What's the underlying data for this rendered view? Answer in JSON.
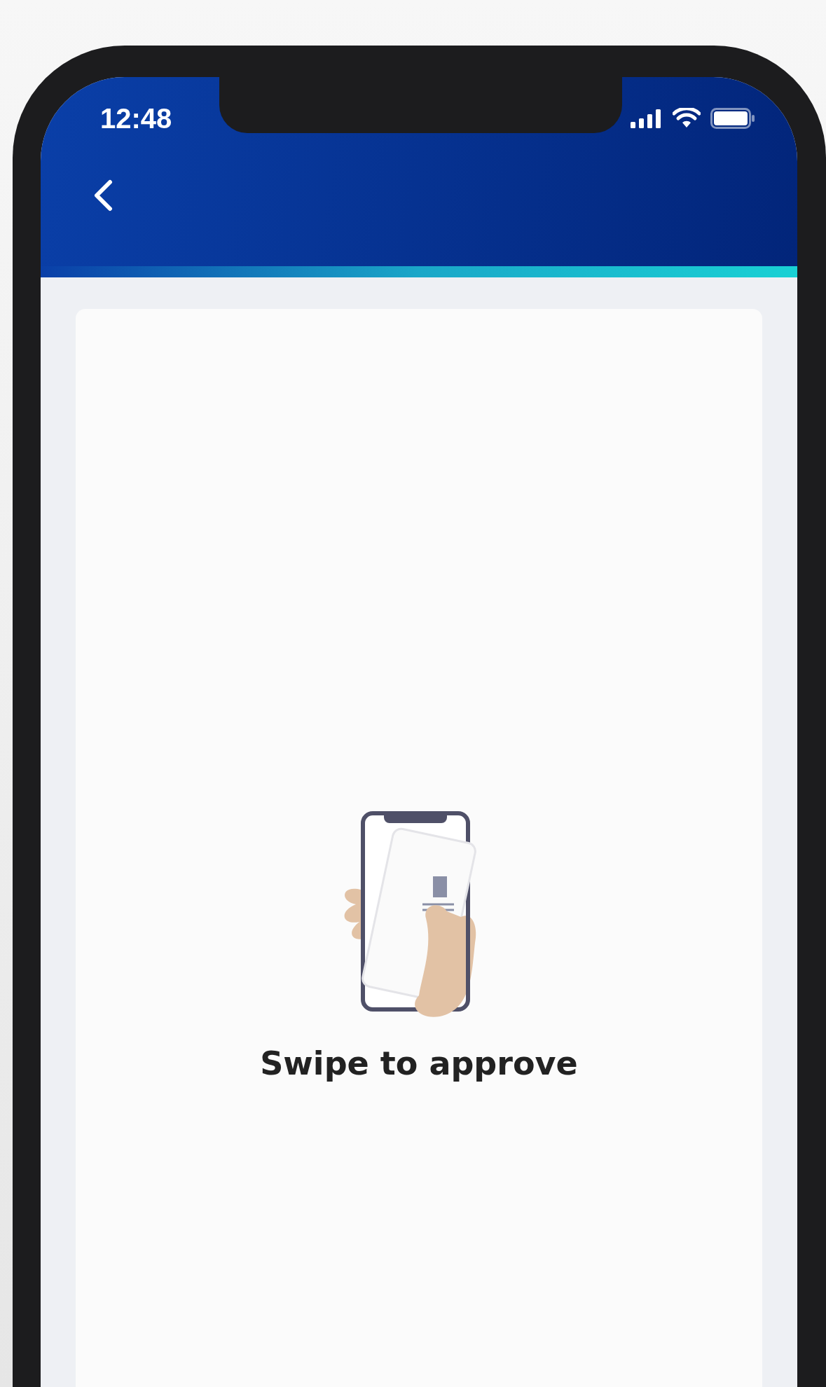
{
  "status_bar": {
    "time": "12:48"
  },
  "message": "Swipe to approve"
}
